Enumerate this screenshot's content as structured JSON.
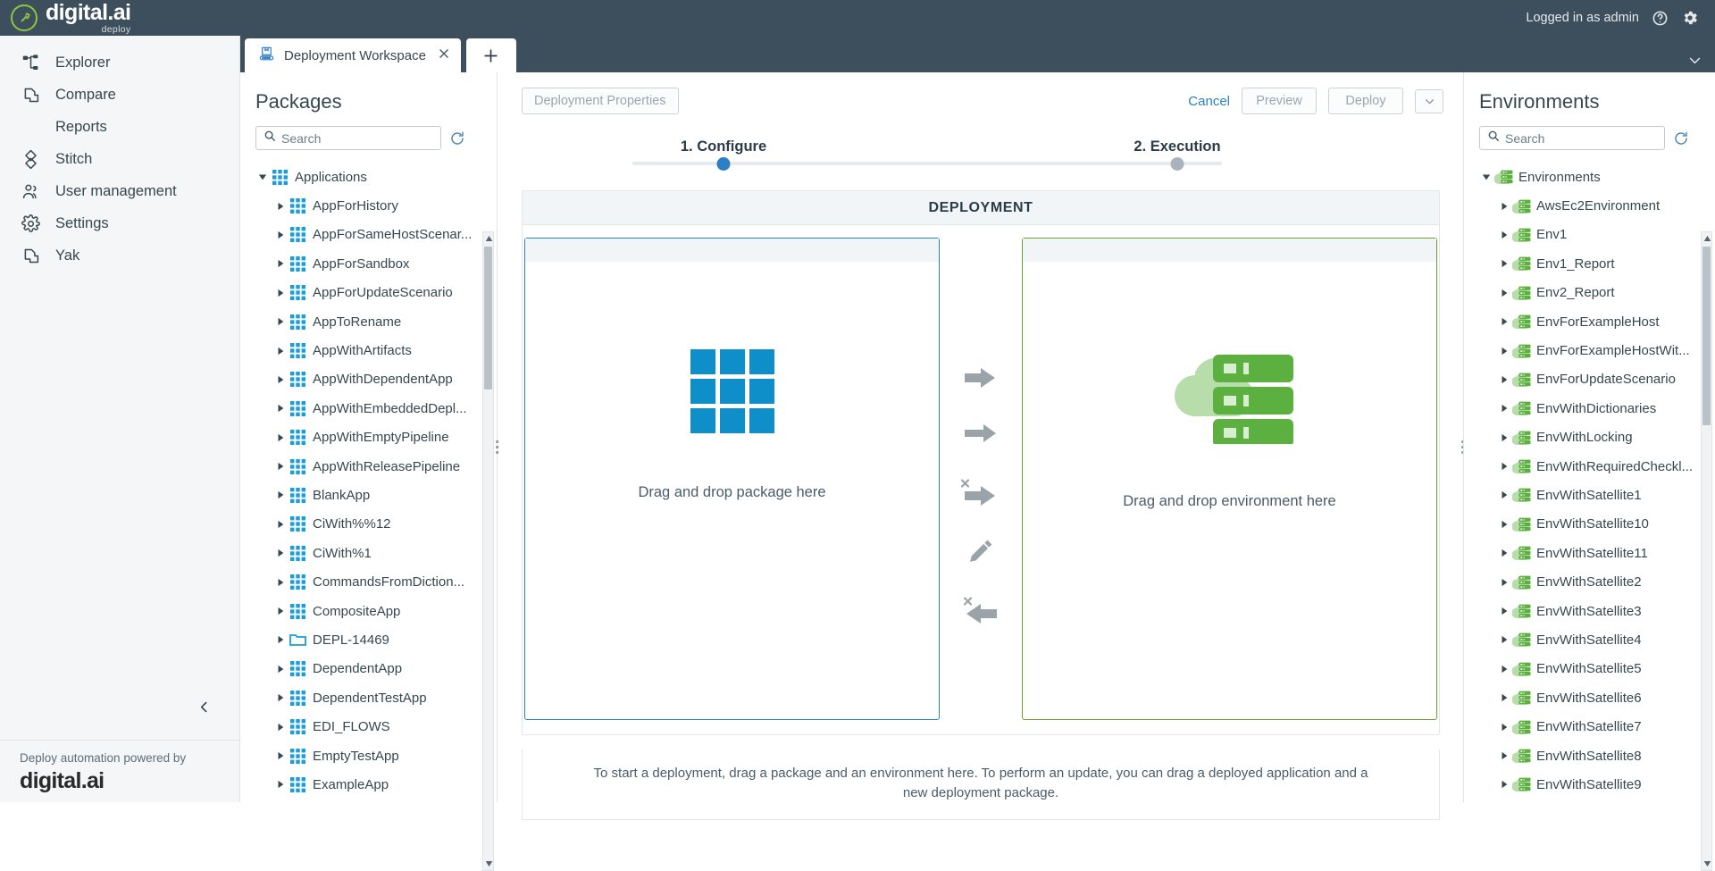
{
  "topbar": {
    "brand_name": "digital.ai",
    "brand_sub": "deploy",
    "logged_in": "Logged in as admin",
    "help_icon": "help-circle-icon",
    "settings_icon": "gear-icon"
  },
  "leftnav": {
    "items": [
      {
        "label": "Explorer",
        "icon": "sitemap-icon"
      },
      {
        "label": "Compare",
        "icon": "compare-icon"
      },
      {
        "label": "Reports",
        "icon": "none"
      },
      {
        "label": "Stitch",
        "icon": "stitch-icon"
      },
      {
        "label": "User management",
        "icon": "users-icon"
      },
      {
        "label": "Settings",
        "icon": "gear-icon"
      },
      {
        "label": "Yak",
        "icon": "yak-icon"
      }
    ],
    "collapse_icon": "chevron-left-icon",
    "footer_text": "Deploy automation powered by",
    "footer_logo": "digital.ai"
  },
  "tabs": {
    "active_tab": "Deployment Workspace",
    "tab_icon": "conveyor-package-icon",
    "close_icon": "close-icon",
    "add_label": "+",
    "dropdown_icon": "chevron-down-icon"
  },
  "packages": {
    "title": "Packages",
    "search_placeholder": "Search",
    "search_value": "",
    "search_icon": "search-icon",
    "refresh_icon": "refresh-icon",
    "tree": [
      {
        "label": "Applications",
        "icon": "grid-icon",
        "depth": 0,
        "expanded": true
      },
      {
        "label": "AppForHistory",
        "icon": "grid-icon",
        "depth": 1,
        "expanded": false
      },
      {
        "label": "AppForSameHostScenar...",
        "icon": "grid-icon",
        "depth": 1,
        "expanded": false
      },
      {
        "label": "AppForSandbox",
        "icon": "grid-icon",
        "depth": 1,
        "expanded": false
      },
      {
        "label": "AppForUpdateScenario",
        "icon": "grid-icon",
        "depth": 1,
        "expanded": false
      },
      {
        "label": "AppToRename",
        "icon": "grid-icon",
        "depth": 1,
        "expanded": false
      },
      {
        "label": "AppWithArtifacts",
        "icon": "grid-icon",
        "depth": 1,
        "expanded": false
      },
      {
        "label": "AppWithDependentApp",
        "icon": "grid-icon",
        "depth": 1,
        "expanded": false
      },
      {
        "label": "AppWithEmbeddedDepl...",
        "icon": "grid-icon",
        "depth": 1,
        "expanded": false
      },
      {
        "label": "AppWithEmptyPipeline",
        "icon": "grid-icon",
        "depth": 1,
        "expanded": false
      },
      {
        "label": "AppWithReleasePipeline",
        "icon": "grid-icon",
        "depth": 1,
        "expanded": false
      },
      {
        "label": "BlankApp",
        "icon": "grid-icon",
        "depth": 1,
        "expanded": false
      },
      {
        "label": "CiWith%%12",
        "icon": "grid-icon",
        "depth": 1,
        "expanded": false
      },
      {
        "label": "CiWith%1",
        "icon": "grid-icon",
        "depth": 1,
        "expanded": false
      },
      {
        "label": "CommandsFromDiction...",
        "icon": "grid-icon",
        "depth": 1,
        "expanded": false
      },
      {
        "label": "CompositeApp",
        "icon": "grid-icon",
        "depth": 1,
        "expanded": false
      },
      {
        "label": "DEPL-14469",
        "icon": "folder-icon",
        "depth": 1,
        "expanded": false
      },
      {
        "label": "DependentApp",
        "icon": "grid-icon",
        "depth": 1,
        "expanded": false
      },
      {
        "label": "DependentTestApp",
        "icon": "grid-icon",
        "depth": 1,
        "expanded": false
      },
      {
        "label": "EDI_FLOWS",
        "icon": "grid-icon",
        "depth": 1,
        "expanded": false
      },
      {
        "label": "EmptyTestApp",
        "icon": "grid-icon",
        "depth": 1,
        "expanded": false
      },
      {
        "label": "ExampleApp",
        "icon": "grid-icon",
        "depth": 1,
        "expanded": false
      }
    ]
  },
  "center": {
    "deployment_properties_label": "Deployment Properties",
    "cancel_label": "Cancel",
    "preview_label": "Preview",
    "deploy_label": "Deploy",
    "split_icon": "chevron-down-icon",
    "steps": [
      {
        "label": "1. Configure",
        "active": true,
        "color": "#2b7fc4"
      },
      {
        "label": "2. Execution",
        "active": false,
        "color": "#a8b4bd"
      }
    ],
    "panel_header": "DEPLOYMENT",
    "package_drop_text": "Drag and drop package here",
    "environment_drop_text": "Drag and drop environment here",
    "package_art_icon": "grid-9-icon",
    "environment_art_icon": "cloud-servers-icon",
    "actions": [
      {
        "icon": "arrow-right-thick-icon",
        "name": "deploy-arrow"
      },
      {
        "icon": "arrow-right-icon",
        "name": "plain-arrow"
      },
      {
        "icon": "arrow-right-undeploy-icon",
        "name": "undeploy-arrow"
      },
      {
        "icon": "pencil-icon",
        "name": "edit-pencil"
      },
      {
        "icon": "arrow-left-undeploy-icon",
        "name": "rollback-arrow"
      }
    ],
    "hint": "To start a deployment, drag a package and an environment here. To perform an update, you can drag a deployed application and a new deployment package."
  },
  "environments": {
    "title": "Environments",
    "search_placeholder": "Search",
    "search_value": "",
    "search_icon": "search-icon",
    "refresh_icon": "refresh-icon",
    "tree": [
      {
        "label": "Environments",
        "depth": 0,
        "expanded": true
      },
      {
        "label": "AwsEc2Environment",
        "depth": 1,
        "expanded": false
      },
      {
        "label": "Env1",
        "depth": 1,
        "expanded": false
      },
      {
        "label": "Env1_Report",
        "depth": 1,
        "expanded": false
      },
      {
        "label": "Env2_Report",
        "depth": 1,
        "expanded": false
      },
      {
        "label": "EnvForExampleHost",
        "depth": 1,
        "expanded": false
      },
      {
        "label": "EnvForExampleHostWit...",
        "depth": 1,
        "expanded": false
      },
      {
        "label": "EnvForUpdateScenario",
        "depth": 1,
        "expanded": false
      },
      {
        "label": "EnvWithDictionaries",
        "depth": 1,
        "expanded": false
      },
      {
        "label": "EnvWithLocking",
        "depth": 1,
        "expanded": false
      },
      {
        "label": "EnvWithRequiredCheckl...",
        "depth": 1,
        "expanded": false
      },
      {
        "label": "EnvWithSatellite1",
        "depth": 1,
        "expanded": false
      },
      {
        "label": "EnvWithSatellite10",
        "depth": 1,
        "expanded": false
      },
      {
        "label": "EnvWithSatellite11",
        "depth": 1,
        "expanded": false
      },
      {
        "label": "EnvWithSatellite2",
        "depth": 1,
        "expanded": false
      },
      {
        "label": "EnvWithSatellite3",
        "depth": 1,
        "expanded": false
      },
      {
        "label": "EnvWithSatellite4",
        "depth": 1,
        "expanded": false
      },
      {
        "label": "EnvWithSatellite5",
        "depth": 1,
        "expanded": false
      },
      {
        "label": "EnvWithSatellite6",
        "depth": 1,
        "expanded": false
      },
      {
        "label": "EnvWithSatellite7",
        "depth": 1,
        "expanded": false
      },
      {
        "label": "EnvWithSatellite8",
        "depth": 1,
        "expanded": false
      },
      {
        "label": "EnvWithSatellite9",
        "depth": 1,
        "expanded": false
      }
    ]
  },
  "colors": {
    "brand_dark": "#3d4f5d",
    "accent_blue": "#2b7fc4",
    "accent_green": "#6b9f2f",
    "tree_blue": "#1b9dd9",
    "tree_green": "#62b245"
  }
}
